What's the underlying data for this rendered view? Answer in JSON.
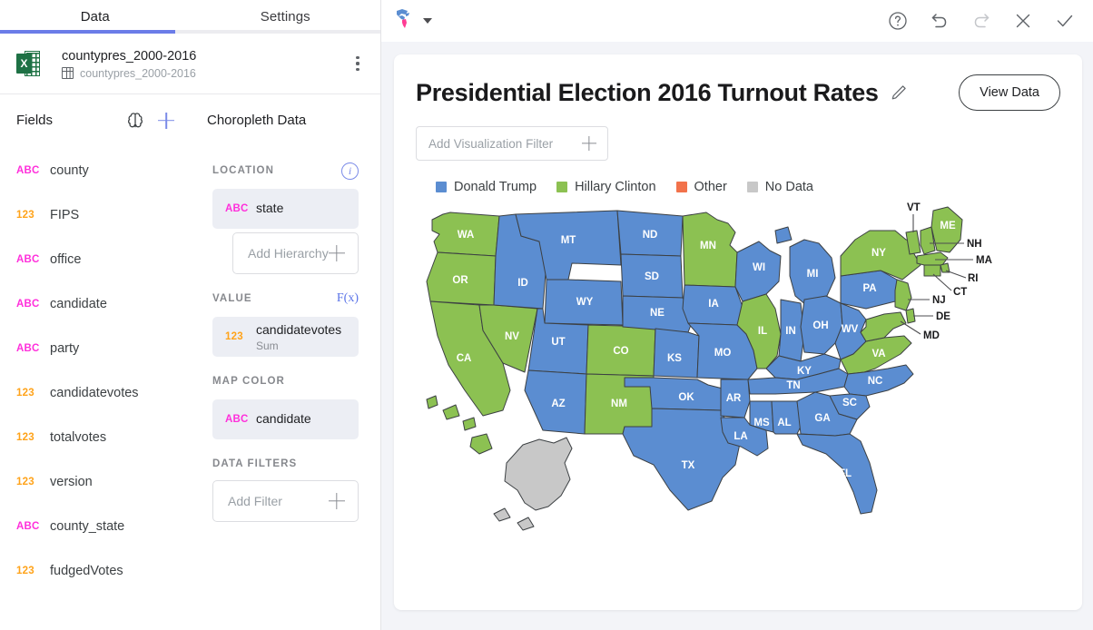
{
  "left": {
    "tabs": [
      {
        "label": "Data",
        "active": true
      },
      {
        "label": "Settings",
        "active": false
      }
    ],
    "dataset": {
      "icon": "excel-icon",
      "name": "countypres_2000-2016",
      "table": "countypres_2000-2016",
      "menu_icon": "kebab-menu-icon"
    },
    "fields_pane": {
      "title": "Fields",
      "ai_icon": "brain-icon",
      "add_icon": "plus-icon",
      "items": [
        {
          "type": "ABC",
          "label": "county"
        },
        {
          "type": "123",
          "label": "FIPS"
        },
        {
          "type": "ABC",
          "label": "office"
        },
        {
          "type": "ABC",
          "label": "candidate"
        },
        {
          "type": "ABC",
          "label": "party"
        },
        {
          "type": "123",
          "label": "candidatevotes"
        },
        {
          "type": "123",
          "label": "totalvotes"
        },
        {
          "type": "123",
          "label": "version"
        },
        {
          "type": "ABC",
          "label": "county_state"
        },
        {
          "type": "123",
          "label": "fudgedVotes"
        }
      ]
    },
    "choropleth_pane": {
      "title": "Choropleth Data",
      "sections": {
        "location": {
          "label": "LOCATION",
          "info_icon": "info-icon",
          "chip": {
            "type": "ABC",
            "name": "state"
          },
          "add_hierarchy": "Add Hierarchy"
        },
        "value": {
          "label": "VALUE",
          "fx_label": "F(x)",
          "chip": {
            "type": "123",
            "name": "candidatevotes",
            "aggregation": "Sum"
          }
        },
        "map_color": {
          "label": "MAP COLOR",
          "chip": {
            "type": "ABC",
            "name": "candidate"
          }
        },
        "data_filters": {
          "label": "DATA FILTERS",
          "add_filter": "Add Filter"
        }
      }
    }
  },
  "right": {
    "toolbar": {
      "viz_type_icon": "americas-map-icon",
      "dropdown_icon": "chevron-down-icon",
      "buttons": [
        {
          "name": "help-button",
          "icon": "question-circle-icon",
          "enabled": true
        },
        {
          "name": "undo-button",
          "icon": "undo-arrow-icon",
          "enabled": true
        },
        {
          "name": "redo-button",
          "icon": "redo-arrow-icon",
          "enabled": false
        },
        {
          "name": "close-button",
          "icon": "close-x-icon",
          "enabled": true
        },
        {
          "name": "confirm-button",
          "icon": "checkmark-icon",
          "enabled": true
        }
      ]
    },
    "viz": {
      "title": "Presidential Election 2016 Turnout Rates",
      "edit_icon": "pencil-icon",
      "view_data_label": "View Data",
      "filter_placeholder": "Add Visualization Filter"
    }
  },
  "chart_data": {
    "type": "choropleth",
    "title": "Presidential Election 2016 Turnout Rates",
    "region": "United States",
    "value_field": "candidatevotes (Sum)",
    "color_field": "candidate",
    "legend_position": "top-left",
    "legend": [
      {
        "label": "Donald Trump",
        "color": "#5b8dd1"
      },
      {
        "label": "Hillary Clinton",
        "color": "#8cc152"
      },
      {
        "label": "Other",
        "color": "#f2724b"
      },
      {
        "label": "No Data",
        "color": "#c8c8c8"
      }
    ],
    "categories": [
      "Donald Trump",
      "Hillary Clinton",
      "Other",
      "No Data"
    ],
    "states": [
      {
        "code": "WA",
        "winner": "Hillary Clinton",
        "color": "#8cc152"
      },
      {
        "code": "OR",
        "winner": "Hillary Clinton",
        "color": "#8cc152"
      },
      {
        "code": "CA",
        "winner": "Hillary Clinton",
        "color": "#8cc152"
      },
      {
        "code": "NV",
        "winner": "Hillary Clinton",
        "color": "#8cc152"
      },
      {
        "code": "ID",
        "winner": "Donald Trump",
        "color": "#5b8dd1"
      },
      {
        "code": "MT",
        "winner": "Donald Trump",
        "color": "#5b8dd1"
      },
      {
        "code": "WY",
        "winner": "Donald Trump",
        "color": "#5b8dd1"
      },
      {
        "code": "UT",
        "winner": "Donald Trump",
        "color": "#5b8dd1"
      },
      {
        "code": "AZ",
        "winner": "Donald Trump",
        "color": "#5b8dd1"
      },
      {
        "code": "NM",
        "winner": "Hillary Clinton",
        "color": "#8cc152"
      },
      {
        "code": "CO",
        "winner": "Hillary Clinton",
        "color": "#8cc152"
      },
      {
        "code": "ND",
        "winner": "Donald Trump",
        "color": "#5b8dd1"
      },
      {
        "code": "SD",
        "winner": "Donald Trump",
        "color": "#5b8dd1"
      },
      {
        "code": "NE",
        "winner": "Donald Trump",
        "color": "#5b8dd1"
      },
      {
        "code": "KS",
        "winner": "Donald Trump",
        "color": "#5b8dd1"
      },
      {
        "code": "OK",
        "winner": "Donald Trump",
        "color": "#5b8dd1"
      },
      {
        "code": "TX",
        "winner": "Donald Trump",
        "color": "#5b8dd1"
      },
      {
        "code": "MN",
        "winner": "Hillary Clinton",
        "color": "#8cc152"
      },
      {
        "code": "IA",
        "winner": "Donald Trump",
        "color": "#5b8dd1"
      },
      {
        "code": "MO",
        "winner": "Donald Trump",
        "color": "#5b8dd1"
      },
      {
        "code": "AR",
        "winner": "Donald Trump",
        "color": "#5b8dd1"
      },
      {
        "code": "LA",
        "winner": "Donald Trump",
        "color": "#5b8dd1"
      },
      {
        "code": "WI",
        "winner": "Donald Trump",
        "color": "#5b8dd1"
      },
      {
        "code": "IL",
        "winner": "Hillary Clinton",
        "color": "#8cc152"
      },
      {
        "code": "MS",
        "winner": "Donald Trump",
        "color": "#5b8dd1"
      },
      {
        "code": "AL",
        "winner": "Donald Trump",
        "color": "#5b8dd1"
      },
      {
        "code": "MI",
        "winner": "Donald Trump",
        "color": "#5b8dd1"
      },
      {
        "code": "IN",
        "winner": "Donald Trump",
        "color": "#5b8dd1"
      },
      {
        "code": "KY",
        "winner": "Donald Trump",
        "color": "#5b8dd1"
      },
      {
        "code": "TN",
        "winner": "Donald Trump",
        "color": "#5b8dd1"
      },
      {
        "code": "GA",
        "winner": "Donald Trump",
        "color": "#5b8dd1"
      },
      {
        "code": "FL",
        "winner": "Donald Trump",
        "color": "#5b8dd1"
      },
      {
        "code": "OH",
        "winner": "Donald Trump",
        "color": "#5b8dd1"
      },
      {
        "code": "WV",
        "winner": "Donald Trump",
        "color": "#5b8dd1"
      },
      {
        "code": "SC",
        "winner": "Donald Trump",
        "color": "#5b8dd1"
      },
      {
        "code": "NC",
        "winner": "Donald Trump",
        "color": "#5b8dd1"
      },
      {
        "code": "VA",
        "winner": "Hillary Clinton",
        "color": "#8cc152"
      },
      {
        "code": "PA",
        "winner": "Donald Trump",
        "color": "#5b8dd1"
      },
      {
        "code": "NY",
        "winner": "Hillary Clinton",
        "color": "#8cc152"
      },
      {
        "code": "VT",
        "winner": "Hillary Clinton",
        "color": "#8cc152"
      },
      {
        "code": "NH",
        "winner": "Hillary Clinton",
        "color": "#8cc152"
      },
      {
        "code": "ME",
        "winner": "Hillary Clinton",
        "color": "#8cc152"
      },
      {
        "code": "MA",
        "winner": "Hillary Clinton",
        "color": "#8cc152"
      },
      {
        "code": "RI",
        "winner": "Hillary Clinton",
        "color": "#8cc152"
      },
      {
        "code": "CT",
        "winner": "Hillary Clinton",
        "color": "#8cc152"
      },
      {
        "code": "NJ",
        "winner": "Hillary Clinton",
        "color": "#8cc152"
      },
      {
        "code": "DE",
        "winner": "Hillary Clinton",
        "color": "#8cc152"
      },
      {
        "code": "MD",
        "winner": "Hillary Clinton",
        "color": "#8cc152"
      },
      {
        "code": "HI",
        "winner": "Hillary Clinton",
        "color": "#8cc152"
      },
      {
        "code": "AK",
        "winner": "No Data",
        "color": "#c8c8c8"
      }
    ]
  }
}
